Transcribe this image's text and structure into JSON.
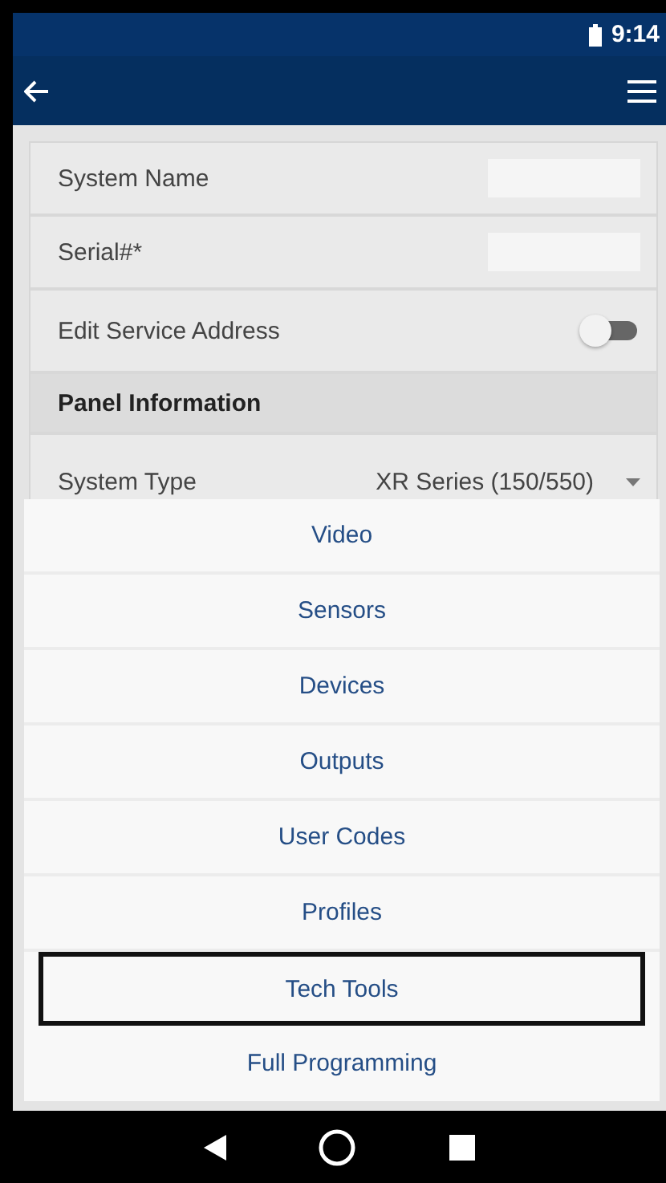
{
  "status_bar": {
    "time": "9:14"
  },
  "form": {
    "fields": [
      {
        "kind": "input",
        "label": "System Name"
      },
      {
        "kind": "input",
        "label": "Serial#*"
      },
      {
        "kind": "toggle",
        "label": "Edit Service Address",
        "on": false
      },
      {
        "kind": "header",
        "label": "Panel Information"
      },
      {
        "kind": "select",
        "label": "System Type",
        "value": "XR Series (150/550)"
      }
    ]
  },
  "action_sheet": {
    "items": [
      {
        "label": "Video",
        "selected": false
      },
      {
        "label": "Sensors",
        "selected": false
      },
      {
        "label": "Devices",
        "selected": false
      },
      {
        "label": "Outputs",
        "selected": false
      },
      {
        "label": "User Codes",
        "selected": false
      },
      {
        "label": "Profiles",
        "selected": false
      },
      {
        "label": "Tech Tools",
        "selected": true
      },
      {
        "label": "Full Programming",
        "selected": false
      }
    ]
  }
}
